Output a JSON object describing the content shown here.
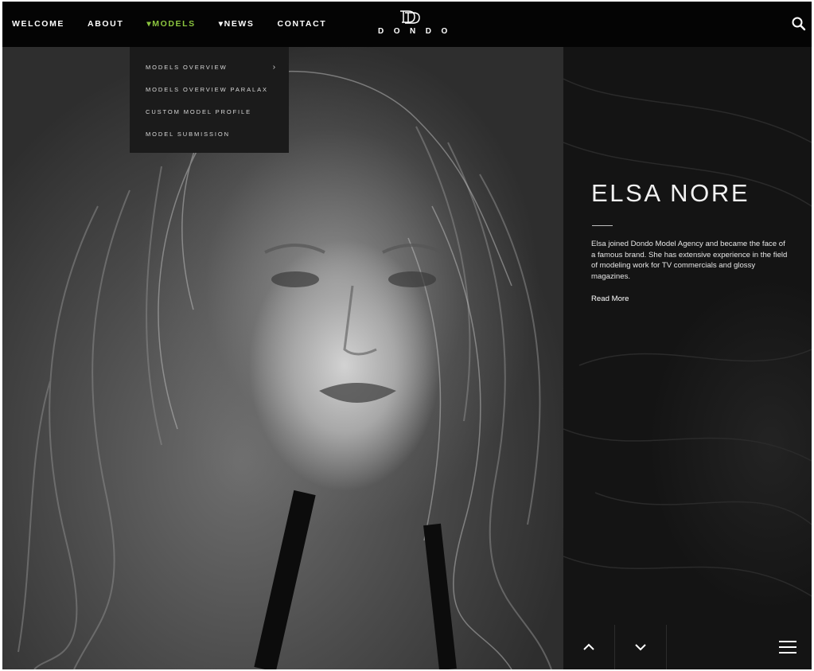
{
  "nav": {
    "items": [
      {
        "label": "WELCOME"
      },
      {
        "label": "ABOUT"
      },
      {
        "label": "▾MODELS"
      },
      {
        "label": "▾NEWS"
      },
      {
        "label": "CONTACT"
      }
    ],
    "active_color": "#8cc63f"
  },
  "logo": {
    "text": "DONDO"
  },
  "dropdown": {
    "items": [
      {
        "label": "MODELS OVERVIEW",
        "arrow": "›"
      },
      {
        "label": "MODELS OVERVIEW PARALAX"
      },
      {
        "label": "CUSTOM MODEL PROFILE"
      },
      {
        "label": "MODEL SUBMISSION"
      }
    ]
  },
  "hero": {
    "name": "ELSA NORE",
    "bio": "Elsa joined Dondo Model Agency and became the face of a famous brand. She has extensive experience in the field of modeling work for TV commercials and glossy magazines.",
    "read_more": "Read More"
  },
  "icons": {
    "search": "search-icon",
    "up": "chevron-up-icon",
    "down": "chevron-down-icon",
    "menu": "hamburger-menu-icon"
  }
}
